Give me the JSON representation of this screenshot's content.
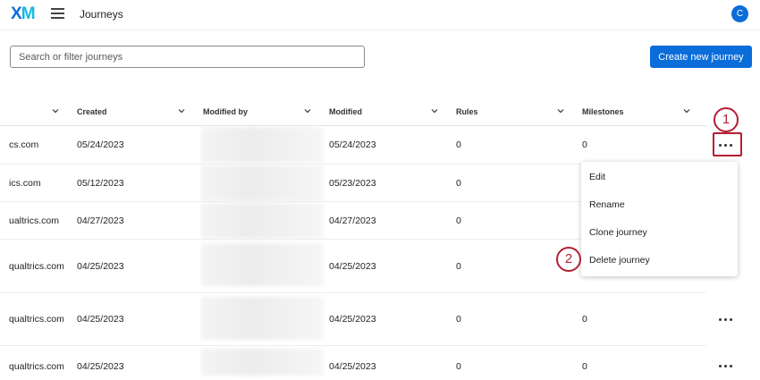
{
  "header": {
    "logo_x": "X",
    "logo_m": "M",
    "title": "Journeys",
    "avatar_initial": "C"
  },
  "search": {
    "placeholder": "Search or filter journeys",
    "value": ""
  },
  "toolbar": {
    "create_label": "Create new journey"
  },
  "table": {
    "columns": [
      "Created",
      "Modified by",
      "Modified",
      "Rules",
      "Milestones"
    ],
    "rows": [
      {
        "owner": "cs.com",
        "created": "05/24/2023",
        "modified": "05/24/2023",
        "rules": "0",
        "milestones": "0"
      },
      {
        "owner": "ics.com",
        "created": "05/12/2023",
        "modified": "05/23/2023",
        "rules": "0",
        "milestones": ""
      },
      {
        "owner": "ualtrics.com",
        "created": "04/27/2023",
        "modified": "04/27/2023",
        "rules": "0",
        "milestones": ""
      },
      {
        "owner": "qualtrics.com",
        "created": "04/25/2023",
        "modified": "04/25/2023",
        "rules": "0",
        "milestones": ""
      },
      {
        "owner": "qualtrics.com",
        "created": "04/25/2023",
        "modified": "04/25/2023",
        "rules": "0",
        "milestones": "0"
      },
      {
        "owner": "qualtrics.com",
        "created": "04/25/2023",
        "modified": "04/25/2023",
        "rules": "0",
        "milestones": "0"
      }
    ]
  },
  "context_menu": {
    "items": [
      "Edit",
      "Rename",
      "Clone journey",
      "Delete journey"
    ]
  },
  "callouts": [
    "1",
    "2"
  ],
  "colors": {
    "brand_blue": "#0b6dd9",
    "callout_red": "#b32032"
  }
}
